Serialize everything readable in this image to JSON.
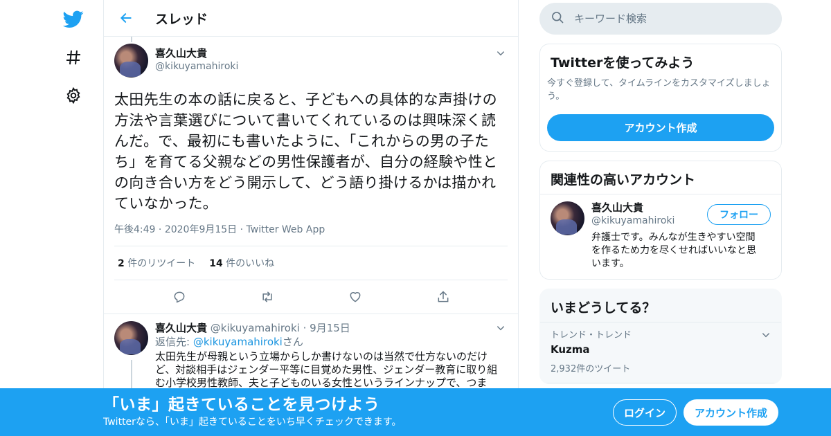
{
  "colors": {
    "brand": "#1da1f2",
    "text": "#14171a",
    "secondary": "#657786",
    "border": "#e6ecf0"
  },
  "nav": {
    "icons": [
      "twitter-logo-icon",
      "hashtag-icon",
      "gear-icon"
    ]
  },
  "header": {
    "title": "スレッド"
  },
  "tweet": {
    "author_name": "喜久山大貴",
    "author_handle": "@kikuyamahiroki",
    "text": "太田先生の本の話に戻ると、子どもへの具体的な声掛けの方法や言葉選びについて書いてくれているのは興味深く読んだ。で、最初にも書いたように、「これからの男の子たち」を育てる父親などの男性保護者が、自分の経験や性との向き合い方をどう開示して、どう語り掛けるかは描かれていなかった。",
    "time": "午後4:49",
    "date": "2020年9月15日",
    "source": "Twitter Web App",
    "retweet_count": "2",
    "retweet_label": "件のリツイート",
    "like_count": "14",
    "like_label": "件のいいね"
  },
  "reply": {
    "author_name": "喜久山大貴",
    "author_handle": "@kikuyamahiroki",
    "date": "9月15日",
    "reply_to_label": "返信先:",
    "reply_to_handle": "@kikuyamahiroki",
    "reply_to_suffix": "さん",
    "text": "太田先生が母親という立場からしか書けないのは当然で仕方ないのだけど、対談相手はジェンダー平等に目覚めた男性、ジェンダー教育に取り組む小学校男性教師、夫と子どものいる女性というラインナップで、つま"
  },
  "search": {
    "placeholder": "キーワード検索"
  },
  "signup_card": {
    "title": "Twitterを使ってみよう",
    "description": "今すぐ登録して、タイムラインをカスタマイズしましょう。",
    "button": "アカウント作成"
  },
  "related": {
    "title": "関連性の高いアカウント",
    "name": "喜久山大貴",
    "handle": "@kikuyamahiroki",
    "bio": "弁護士です。みんなが生きやすい空間を作るため力を尽くせればいいなと思います。",
    "follow": "フォロー"
  },
  "trends": {
    "title": "いまどうしてる？",
    "items": [
      {
        "category": "トレンド・トレンド",
        "name": "Kuzma",
        "count": "2,932件のツイート"
      }
    ]
  },
  "banner": {
    "title": "「いま」起きていることを見つけよう",
    "subtitle": "Twitterなら、「いま」起きていることをいち早くチェックできます。",
    "login": "ログイン",
    "signup": "アカウント作成"
  }
}
